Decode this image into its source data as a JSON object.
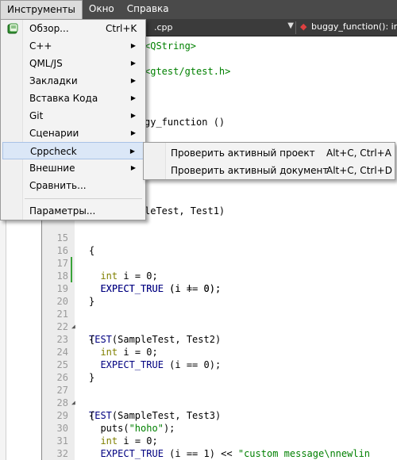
{
  "menubar": {
    "items": [
      {
        "label": "Инструменты",
        "active": true
      },
      {
        "label": "Окно",
        "active": false
      },
      {
        "label": "Справка",
        "active": false
      }
    ]
  },
  "toolbar": {
    "file_name": ".cpp",
    "function_name": "buggy_function(): int"
  },
  "menu": {
    "items": [
      {
        "label": "Обзор...",
        "shortcut": "Ctrl+K",
        "submenu": false,
        "icon": "book-icon"
      },
      {
        "label": "C++",
        "submenu": true
      },
      {
        "label": "QML/JS",
        "submenu": true
      },
      {
        "label": "Закладки",
        "submenu": true
      },
      {
        "label": "Вставка Кода",
        "submenu": true
      },
      {
        "label": "Git",
        "submenu": true
      },
      {
        "label": "Сценарии",
        "submenu": true
      },
      {
        "label": "Cppcheck",
        "submenu": true,
        "highlighted": true
      },
      {
        "label": "Внешние",
        "submenu": true
      },
      {
        "label": "Сравнить...",
        "submenu": false
      },
      {
        "label": "Параметры...",
        "submenu": false
      }
    ]
  },
  "submenu": {
    "items": [
      {
        "label": "Проверить активный проект",
        "shortcut": "Alt+C, Ctrl+A"
      },
      {
        "label": "Проверить активный документ",
        "shortcut": "Alt+C, Ctrl+D"
      }
    ]
  },
  "code": {
    "partial_lines": [
      "<QString>",
      "<gtest/gtest.h>",
      "gy_function ()",
      "leTest, Test1)"
    ],
    "lines": [
      {
        "n": "15",
        "text": "{"
      },
      {
        "n": "16",
        "text": "  int i = 0;"
      },
      {
        "n": "17",
        "text": "  EXPECT_TRUE (i == 0);"
      },
      {
        "n": "18",
        "text": "  EXPECT_TRUE (i != 0);"
      },
      {
        "n": "19",
        "text": "}"
      },
      {
        "n": "20",
        "text": ""
      },
      {
        "n": "21",
        "text": "TEST(SampleTest, Test2)"
      },
      {
        "n": "22",
        "text": "{"
      },
      {
        "n": "23",
        "text": "  int i = 0;"
      },
      {
        "n": "24",
        "text": "  EXPECT_TRUE (i == 0);"
      },
      {
        "n": "25",
        "text": "}"
      },
      {
        "n": "26",
        "text": ""
      },
      {
        "n": "27",
        "text": "TEST(SampleTest, Test3)"
      },
      {
        "n": "28",
        "text": "{"
      },
      {
        "n": "29",
        "text": "  puts(\"hoho\");"
      },
      {
        "n": "30",
        "text": "  int i = 0;"
      },
      {
        "n": "31",
        "text": "  EXPECT_TRUE (i == 1) << \"custom message\\nnewlin"
      },
      {
        "n": "32",
        "text": "}"
      },
      {
        "n": "33",
        "text": ""
      }
    ]
  },
  "colors": {
    "keyword": "#808000",
    "macro": "#000080",
    "string": "#008000",
    "menu_highlight": "#dbe7f7",
    "change_marker": "#39a339"
  }
}
